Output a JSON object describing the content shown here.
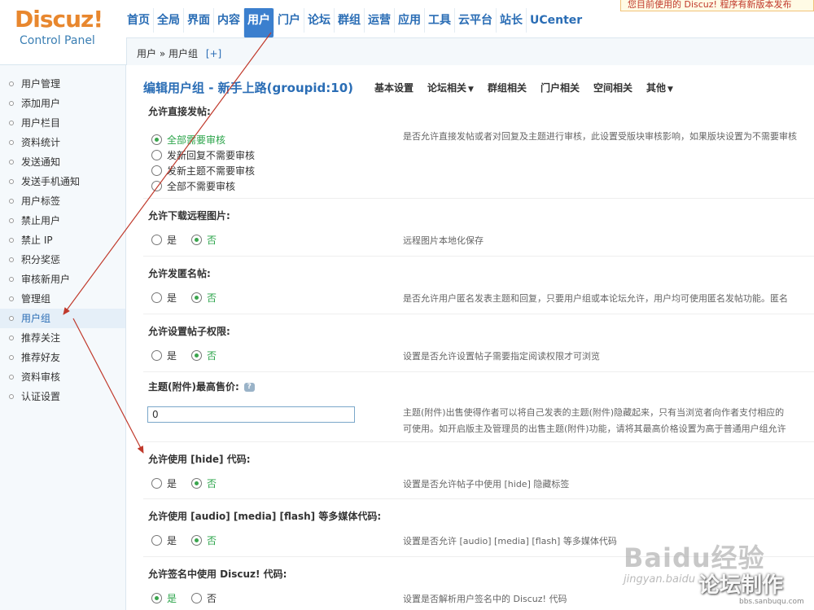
{
  "brand": {
    "name": "Discuz!",
    "subtitle": "Control Panel"
  },
  "notice": "您目前使用的 Discuz! 程序有新版本发布",
  "topnav": [
    {
      "label": "首页"
    },
    {
      "label": "全局"
    },
    {
      "label": "界面"
    },
    {
      "label": "内容"
    },
    {
      "label": "用户",
      "active": true
    },
    {
      "label": "门户"
    },
    {
      "label": "论坛"
    },
    {
      "label": "群组"
    },
    {
      "label": "运营"
    },
    {
      "label": "应用"
    },
    {
      "label": "工具"
    },
    {
      "label": "云平台"
    },
    {
      "label": "站长"
    },
    {
      "label": "UCenter"
    }
  ],
  "breadcrumb": {
    "path": "用户 » 用户组",
    "add": "[+]"
  },
  "sidebar": [
    {
      "label": "用户管理"
    },
    {
      "label": "添加用户"
    },
    {
      "label": "用户栏目"
    },
    {
      "label": "资料统计"
    },
    {
      "label": "发送通知"
    },
    {
      "label": "发送手机通知"
    },
    {
      "label": "用户标签"
    },
    {
      "label": "禁止用户"
    },
    {
      "label": "禁止 IP"
    },
    {
      "label": "积分奖惩"
    },
    {
      "label": "审核新用户"
    },
    {
      "label": "管理组"
    },
    {
      "label": "用户组",
      "active": true
    },
    {
      "label": "推荐关注"
    },
    {
      "label": "推荐好友"
    },
    {
      "label": "资料审核"
    },
    {
      "label": "认证设置"
    }
  ],
  "page": {
    "title": "编辑用户组 - 新手上路(groupid:10)",
    "tabs": [
      {
        "label": "基本设置",
        "caret": ""
      },
      {
        "label": "论坛相关",
        "caret": "▼"
      },
      {
        "label": "群组相关",
        "caret": ""
      },
      {
        "label": "门户相关",
        "caret": ""
      },
      {
        "label": "空间相关",
        "caret": ""
      },
      {
        "label": "其他",
        "caret": "▼"
      }
    ]
  },
  "sections": {
    "post_direct": {
      "label": "允许直接发帖:",
      "options": [
        "全部需要审核",
        "发新回复不需要审核",
        "发新主题不需要审核",
        "全部不需要审核"
      ],
      "selected_index": 0,
      "desc": "是否允许直接发帖或者对回复及主题进行审核，此设置受版块审核影响，如果版块设置为不需要审核"
    },
    "remote_images": {
      "label": "允许下载远程图片:",
      "yes": "是",
      "no": "否",
      "value": "否",
      "desc": "远程图片本地化保存"
    },
    "anonymous": {
      "label": "允许发匿名帖:",
      "yes": "是",
      "no": "否",
      "value": "否",
      "desc": "是否允许用户匿名发表主题和回复，只要用户组或本论坛允许，用户均可使用匿名发帖功能。匿名"
    },
    "post_perm": {
      "label": "允许设置帖子权限:",
      "yes": "是",
      "no": "否",
      "value": "否",
      "desc": "设置是否允许设置帖子需要指定阅读权限才可浏览"
    },
    "max_price": {
      "label": "主题(附件)最高售价:",
      "help": "?",
      "value": "0",
      "desc1": "主题(附件)出售使得作者可以将自己发表的主题(附件)隐藏起来，只有当浏览者向作者支付相应的",
      "desc2": "可使用。如开启版主及管理员的出售主题(附件)功能，请将其最高价格设置为高于普通用户组允许"
    },
    "hide_code": {
      "label": "允许使用 [hide] 代码:",
      "yes": "是",
      "no": "否",
      "value": "否",
      "desc": "设置是否允许帖子中使用 [hide] 隐藏标签"
    },
    "media_code": {
      "label": "允许使用 [audio] [media] [flash] 等多媒体代码:",
      "yes": "是",
      "no": "否",
      "value": "否",
      "desc": "设置是否允许 [audio] [media] [flash] 等多媒体代码"
    },
    "sig_code": {
      "label": "允许签名中使用 Discuz! 代码:",
      "yes": "是",
      "no": "否",
      "value": "是",
      "desc": "设置是否解析用户签名中的 Discuz! 代码"
    }
  },
  "watermark": {
    "baidu": "Baidu经验",
    "url": "jingyan.baidu",
    "brand": "论坛制作",
    "site": "bbs.sanbuqu.com"
  },
  "colors": {
    "accent": "#2a6db5",
    "active_nav": "#3b7fce",
    "selected": "#2ba44a",
    "logo": "#e8872e",
    "annotation": "#c0392b"
  }
}
